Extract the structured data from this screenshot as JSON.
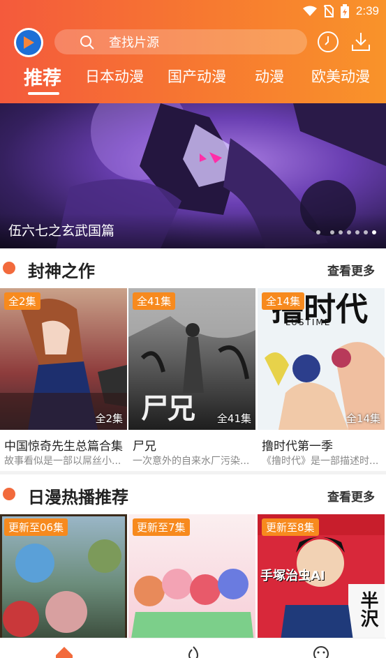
{
  "status": {
    "time": "2:39"
  },
  "header": {
    "search_placeholder": "查找片源",
    "tabs": [
      "推荐",
      "日本动漫",
      "国产动漫",
      "动漫",
      "欧美动漫"
    ],
    "active_tab": "推荐"
  },
  "banner": {
    "title": "伍六七之玄武国篇",
    "dots": 7,
    "active_dot": 1
  },
  "sections": [
    {
      "title": "封神之作",
      "more_label": "查看更多",
      "cards": [
        {
          "badge": "全2集",
          "count": "全2集",
          "title": "中国惊奇先生总篇合集",
          "desc": "故事看似是一部以屌丝小..."
        },
        {
          "badge": "全41集",
          "count": "全41集",
          "title": "尸兄",
          "desc": "一次意外的自来水厂污染..."
        },
        {
          "badge": "全14集",
          "count": "全14集",
          "title": "撸时代第一季",
          "desc": "《撸时代》是一部描述时..."
        }
      ]
    },
    {
      "title": "日漫热播推荐",
      "more_label": "查看更多",
      "cards": [
        {
          "badge": "更新至06集"
        },
        {
          "badge": "更新至7集"
        },
        {
          "badge": "更新至8集"
        }
      ]
    }
  ],
  "thumb_text": {
    "card2_logo": "尸兄",
    "card3_title": "撸时代",
    "card3_sub": "LUSTIME",
    "card6_a": "手塚治虫AI",
    "card6_b": "半沢"
  },
  "colors": {
    "accent": "#f26a3c",
    "badge": "#f78a1e",
    "header_start": "#f45a3c",
    "header_end": "#f9932a"
  }
}
